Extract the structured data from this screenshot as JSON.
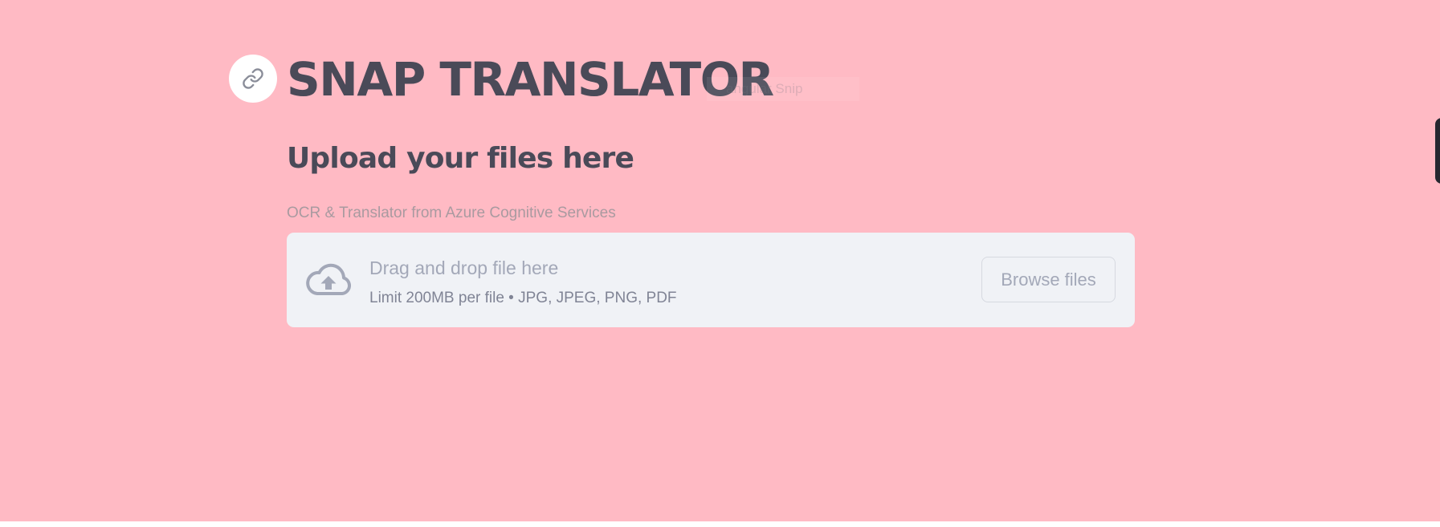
{
  "header": {
    "title": "SNAP TRANSLATOR",
    "anchor_icon": "link-icon",
    "overlay_text": "angular Snip"
  },
  "section": {
    "heading": "Upload your files here"
  },
  "uploader": {
    "label": "OCR & Translator from Azure Cognitive Services",
    "icon": "cloud-upload-icon",
    "instructions": "Drag and drop file here",
    "limit": "Limit 200MB per file • JPG, JPEG, PNG, PDF",
    "browse_label": "Browse files"
  },
  "colors": {
    "background": "#ffbac4",
    "text_dark": "#4a4a58",
    "dropzone_bg": "#f0f2f6",
    "muted_text": "#a3a8b8"
  }
}
